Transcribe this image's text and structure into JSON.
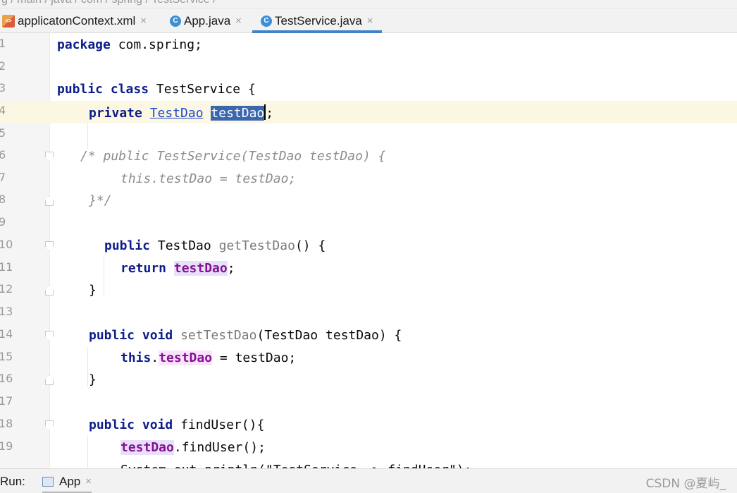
{
  "breadcrumb": {
    "text": "g  /  main  /  java  /  com  /  spring  /  TestService  /"
  },
  "tabs": [
    {
      "label": "applicatonContext.xml",
      "icon": "xml-file-icon"
    },
    {
      "label": "App.java",
      "icon": "java-class-icon"
    },
    {
      "label": "TestService.java",
      "icon": "java-class-icon",
      "active": true
    }
  ],
  "editor": {
    "line_numbers": [
      "1",
      "2",
      "3",
      "4",
      "5",
      "6",
      "7",
      "8",
      "9",
      "10",
      "11",
      "12",
      "13",
      "14",
      "15",
      "16",
      "17",
      "18",
      "19"
    ],
    "current_line": 4,
    "lines": {
      "l1": {
        "kw": "package",
        "rest": " com.spring;"
      },
      "l3": {
        "kw1": "public",
        "kw2": "class",
        "rest": " TestService {"
      },
      "l4": {
        "kw": "private",
        "type": "TestDao",
        "selected": "testDao",
        "end": ";"
      },
      "l6": {
        "text": "/* public TestService(TestDao testDao) {"
      },
      "l7": {
        "text": "this.testDao = testDao;"
      },
      "l8": {
        "text": "}*/"
      },
      "l10": {
        "kw": "public",
        "type": "TestDao",
        "method": "getTestDao",
        "end": "() {"
      },
      "l11": {
        "kw": "return",
        "field": "testDao",
        "end": ";"
      },
      "l12": {
        "text": "}"
      },
      "l14": {
        "kw1": "public",
        "kw2": "void",
        "method": "setTestDao",
        "end": "(TestDao testDao) {"
      },
      "l15": {
        "kw": "this",
        "dot": ".",
        "field": "testDao",
        "end": " = testDao;"
      },
      "l16": {
        "text": "}"
      },
      "l18": {
        "kw1": "public",
        "kw2": "void",
        "rest": " findUser(){"
      },
      "l19": {
        "field": "testDao",
        "end": ".findUser();"
      },
      "l20": {
        "text": "System.out.println(\"TestService -> findUser\");"
      }
    }
  },
  "run": {
    "label": "Run:",
    "tab": "App"
  },
  "watermark": "CSDN @夏屿_",
  "colors": {
    "keyword": "#0d1d8a",
    "field": "#871094",
    "selection": "#3a67ad",
    "accent": "#4083c9",
    "current_line": "#fcf7e3"
  }
}
